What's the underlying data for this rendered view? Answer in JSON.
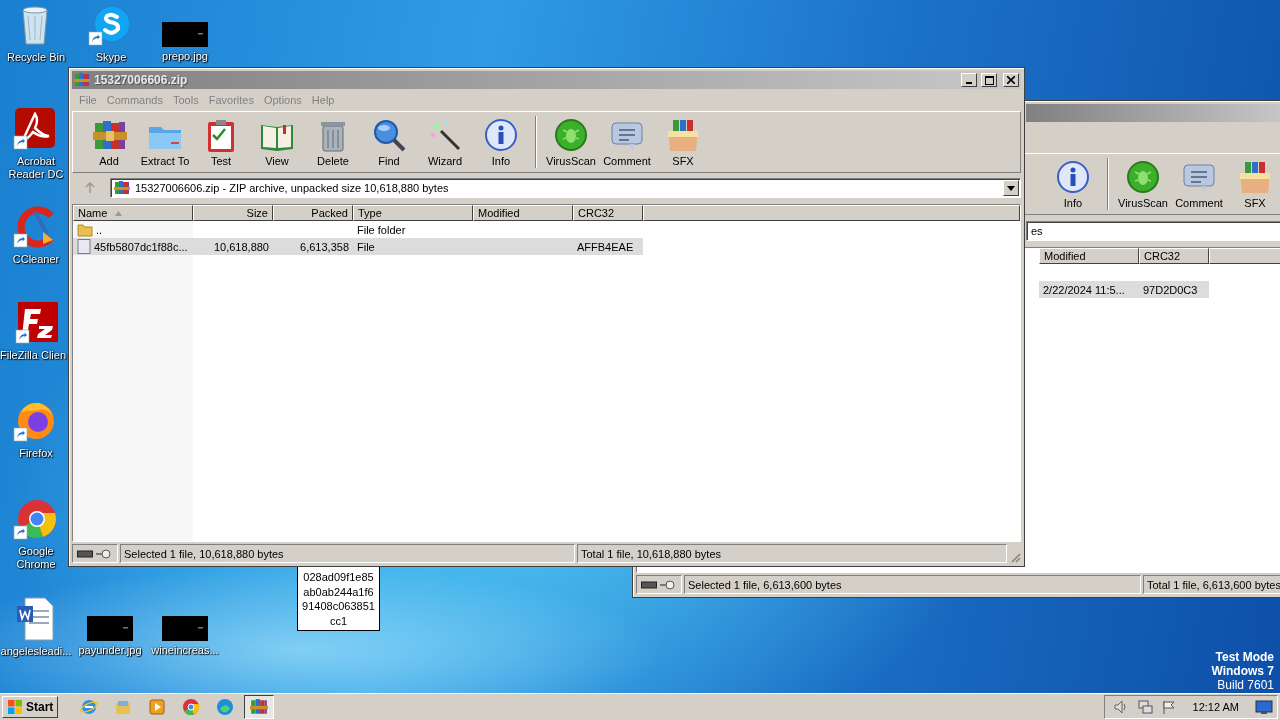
{
  "desktop": {
    "icons": [
      {
        "label": "Recycle Bin",
        "kind": "recycle",
        "shortcut": false
      },
      {
        "label": "Skype",
        "kind": "skype",
        "shortcut": true
      },
      {
        "label": "prepo.jpg",
        "kind": "thumb",
        "shortcut": false
      },
      {
        "label": "Acrobat Reader DC",
        "kind": "acrobat",
        "shortcut": true
      },
      {
        "label": "CCleaner",
        "kind": "ccleaner",
        "shortcut": true
      },
      {
        "label": "FileZilla Clien",
        "kind": "filezilla",
        "shortcut": true
      },
      {
        "label": "Firefox",
        "kind": "firefox",
        "shortcut": true
      },
      {
        "label": "Google Chrome",
        "kind": "chrome",
        "shortcut": true
      },
      {
        "label": "angelesleadi...",
        "kind": "word",
        "shortcut": false
      },
      {
        "label": "payunder.jpg",
        "kind": "thumb",
        "shortcut": false
      },
      {
        "label": "wineincreas...",
        "kind": "thumb",
        "shortcut": false
      }
    ],
    "tooltip": {
      "lines": [
        "028ad09f1e85",
        "ab0ab244a1f6",
        "91408c063851",
        "cc1"
      ]
    },
    "system_text": [
      {
        "text": "Test Mode",
        "bold": true
      },
      {
        "text": "Windows 7",
        "bold": true
      },
      {
        "text": "Build 7601",
        "bold": false
      }
    ]
  },
  "background_window": {
    "active": false,
    "toolbar": [
      {
        "label": "Info",
        "kind": "info",
        "separator_before": false
      },
      {
        "label": "VirusScan",
        "kind": "virusscan",
        "separator_before": true
      },
      {
        "label": "Comment",
        "kind": "comment",
        "separator_before": false
      },
      {
        "label": "SFX",
        "kind": "sfx",
        "separator_before": false
      }
    ],
    "address": "es",
    "columns": [
      {
        "label": "Modified",
        "sorted": false
      },
      {
        "label": "CRC32",
        "sorted": false
      }
    ],
    "rows": [
      {
        "modified": "2/22/2024 11:5...",
        "crc32": "97D2D0C3",
        "selected": true
      }
    ],
    "status": {
      "selected": "Selected 1 file, 6,613,600 bytes",
      "total": "Total 1 file, 6,613,600 bytes"
    }
  },
  "window": {
    "title": "15327006606.zip",
    "active": false,
    "menu": [
      "File",
      "Commands",
      "Tools",
      "Favorites",
      "Options",
      "Help"
    ],
    "toolbar": [
      {
        "label": "Add",
        "kind": "add",
        "separator_before": false
      },
      {
        "label": "Extract To",
        "kind": "extract",
        "separator_before": false
      },
      {
        "label": "Test",
        "kind": "test",
        "separator_before": false
      },
      {
        "label": "View",
        "kind": "view",
        "separator_before": false
      },
      {
        "label": "Delete",
        "kind": "delete",
        "separator_before": false
      },
      {
        "label": "Find",
        "kind": "find",
        "separator_before": false
      },
      {
        "label": "Wizard",
        "kind": "wizard",
        "separator_before": false
      },
      {
        "label": "Info",
        "kind": "info",
        "separator_before": false
      },
      {
        "label": "VirusScan",
        "kind": "virusscan",
        "separator_before": true
      },
      {
        "label": "Comment",
        "kind": "comment",
        "separator_before": false
      },
      {
        "label": "SFX",
        "kind": "sfx",
        "separator_before": false
      }
    ],
    "address": "15327006606.zip - ZIP archive, unpacked size 10,618,880 bytes",
    "columns": [
      {
        "label": "Name",
        "sorted": true
      },
      {
        "label": "Size",
        "sorted": false
      },
      {
        "label": "Packed",
        "sorted": false
      },
      {
        "label": "Type",
        "sorted": false
      },
      {
        "label": "Modified",
        "sorted": false
      },
      {
        "label": "CRC32",
        "sorted": false
      }
    ],
    "rows": [
      {
        "kind": "folder",
        "name": "..",
        "type": "File folder",
        "selected": false
      },
      {
        "kind": "file",
        "name": "45fb5807dc1f88c...",
        "size": "10,618,880",
        "packed": "6,613,358",
        "type": "File",
        "crc32": "AFFB4EAE",
        "selected": true
      }
    ],
    "status": {
      "selected": "Selected 1 file, 10,618,880 bytes",
      "total": "Total 1 file, 10,618,880 bytes"
    }
  },
  "taskbar": {
    "start": "Start",
    "apps": [
      {
        "kind": "ie",
        "pressed": false
      },
      {
        "kind": "explorer",
        "pressed": false
      },
      {
        "kind": "media",
        "pressed": false
      },
      {
        "kind": "chrome",
        "pressed": false
      },
      {
        "kind": "edge",
        "pressed": false
      },
      {
        "kind": "winrar",
        "pressed": true
      }
    ],
    "clock": "12:12 AM"
  }
}
